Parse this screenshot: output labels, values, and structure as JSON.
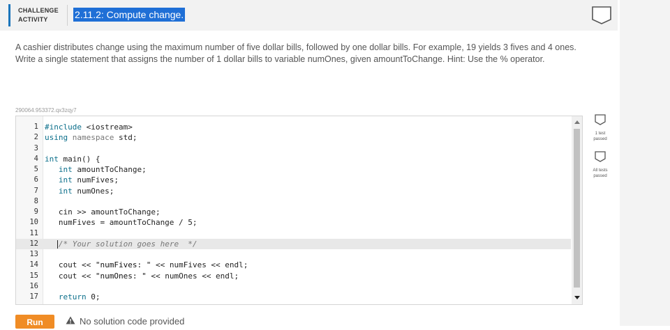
{
  "activity": {
    "type_label_line1": "CHALLENGE",
    "type_label_line2": "ACTIVITY",
    "title": "2.11.2: Compute change."
  },
  "description": {
    "text": "A cashier distributes change using the maximum number of five dollar bills, followed by one dollar bills. For example, 19 yields 3 fives and 4 ones. Write a single statement that assigns the number of 1 dollar bills to variable numOnes, given amountToChange. Hint: Use the % operator."
  },
  "identifier": "290064.953372.qx3zqy7",
  "editor": {
    "line_numbers": [
      "1",
      "2",
      "3",
      "4",
      "5",
      "6",
      "7",
      "8",
      "9",
      "10",
      "11",
      "12",
      "13",
      "14",
      "15",
      "16",
      "17"
    ]
  },
  "tests": [
    {
      "label_line1": "1 test",
      "label_line2": "passed"
    },
    {
      "label_line1": "All tests",
      "label_line2": "passed"
    }
  ],
  "run": {
    "button_label": "Run",
    "status_text": "No solution code provided"
  },
  "colors": {
    "accent": "#1b75bb",
    "title_highlight": "#1f6fd6",
    "run_button": "#f08c25"
  }
}
